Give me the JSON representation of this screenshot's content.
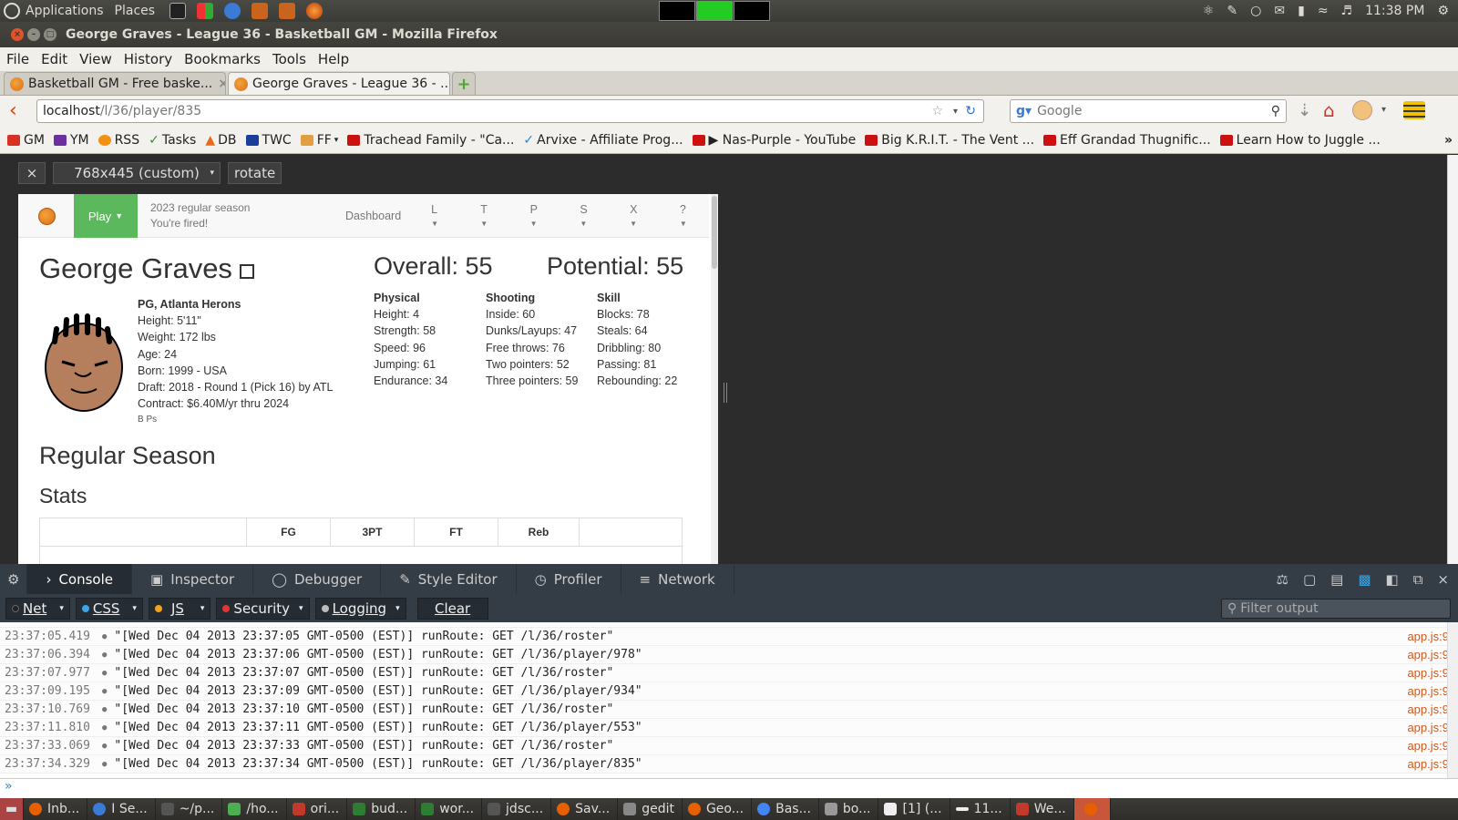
{
  "system": {
    "applications": "Applications",
    "places": "Places",
    "clock": "11:38 PM"
  },
  "window": {
    "title": "George Graves - League 36 - Basketball GM - Mozilla Firefox"
  },
  "menubar": [
    "File",
    "Edit",
    "View",
    "History",
    "Bookmarks",
    "Tools",
    "Help"
  ],
  "tabs": [
    {
      "label": "Basketball GM - Free baske..."
    },
    {
      "label": "George Graves - League 36 - ..."
    }
  ],
  "navbar": {
    "url_host": "localhost",
    "url_path": "/l/36/player/835",
    "search_placeholder": "Google"
  },
  "bookmarks": [
    {
      "label": "GM",
      "color": "#d93025"
    },
    {
      "label": "YM",
      "color": "#6b2fa0"
    },
    {
      "label": "RSS",
      "color": "#f29111"
    },
    {
      "label": "Tasks",
      "color": "#3a8a3a"
    },
    {
      "label": "DB",
      "color": "#e86b1a"
    },
    {
      "label": "TWC",
      "color": "#1a3e9a"
    },
    {
      "label": "FF",
      "color": "#e0a040"
    },
    {
      "label": "Trachead Family - \"Ca...",
      "color": "#cc1111"
    },
    {
      "label": "Arvixe - Affiliate Prog...",
      "color": "#1d8ad6"
    },
    {
      "label": "▶ Nas-Purple - YouTube",
      "color": "#cc1111"
    },
    {
      "label": "Big K.R.I.T. - The Vent ...",
      "color": "#cc1111"
    },
    {
      "label": "Eff Grandad Thugnific...",
      "color": "#cc1111"
    },
    {
      "label": "Learn How to Juggle ...",
      "color": "#cc1111"
    }
  ],
  "rdm": {
    "close": "×",
    "size": "768x445 (custom)",
    "rotate": "rotate"
  },
  "bbgm": {
    "play": "Play",
    "season": "2023 regular season",
    "status": "You're fired!",
    "nav_links": [
      "Dashboard",
      "L",
      "T",
      "P",
      "S",
      "X",
      "?"
    ],
    "player_name": "George Graves",
    "position_team": "PG, Atlanta Herons",
    "height": "Height: 5'11\"",
    "weight": "Weight: 172 lbs",
    "age": "Age: 24",
    "born": "Born: 1999 - USA",
    "draft": "Draft: 2018 - Round 1 (Pick 16) by ATL",
    "contract": "Contract: $6.40M/yr thru 2024",
    "skills_tags": "B Ps",
    "overall": "Overall: 55",
    "potential": "Potential: 55",
    "ratings": [
      {
        "heading": "Physical",
        "items": [
          "Height: 4",
          "Strength: 58",
          "Speed: 96",
          "Jumping: 61",
          "Endurance: 34"
        ]
      },
      {
        "heading": "Shooting",
        "items": [
          "Inside: 60",
          "Dunks/Layups: 47",
          "Free throws: 76",
          "Two pointers: 52",
          "Three pointers: 59"
        ]
      },
      {
        "heading": "Skill",
        "items": [
          "Blocks: 78",
          "Steals: 64",
          "Dribbling: 80",
          "Passing: 81",
          "Rebounding: 22"
        ]
      }
    ],
    "section_title": "Regular Season",
    "subsection_title": "Stats",
    "stat_groups": [
      "FG",
      "3PT",
      "FT",
      "Reb"
    ]
  },
  "devtools": {
    "tabs": [
      "Console",
      "Inspector",
      "Debugger",
      "Style Editor",
      "Profiler",
      "Network"
    ],
    "filters": [
      {
        "label": "Net",
        "dot": "#222"
      },
      {
        "label": "CSS",
        "dot": "#3aa6e6"
      },
      {
        "label": "JS",
        "dot": "#f2a51a"
      },
      {
        "label": "Security",
        "dot": "#e23434"
      },
      {
        "label": "Logging",
        "dot": "#bbbbbb"
      }
    ],
    "clear": "Clear",
    "filter_placeholder": "Filter output",
    "logs": [
      {
        "ts": "23:37:05.419",
        "msg": "\"[Wed Dec 04 2013 23:37:05 GMT-0500 (EST)] runRoute: GET /l/36/roster\"",
        "src": "app.js:9"
      },
      {
        "ts": "23:37:06.394",
        "msg": "\"[Wed Dec 04 2013 23:37:06 GMT-0500 (EST)] runRoute: GET /l/36/player/978\"",
        "src": "app.js:9"
      },
      {
        "ts": "23:37:07.977",
        "msg": "\"[Wed Dec 04 2013 23:37:07 GMT-0500 (EST)] runRoute: GET /l/36/roster\"",
        "src": "app.js:9"
      },
      {
        "ts": "23:37:09.195",
        "msg": "\"[Wed Dec 04 2013 23:37:09 GMT-0500 (EST)] runRoute: GET /l/36/player/934\"",
        "src": "app.js:9"
      },
      {
        "ts": "23:37:10.769",
        "msg": "\"[Wed Dec 04 2013 23:37:10 GMT-0500 (EST)] runRoute: GET /l/36/roster\"",
        "src": "app.js:9"
      },
      {
        "ts": "23:37:11.810",
        "msg": "\"[Wed Dec 04 2013 23:37:11 GMT-0500 (EST)] runRoute: GET /l/36/player/553\"",
        "src": "app.js:9"
      },
      {
        "ts": "23:37:33.069",
        "msg": "\"[Wed Dec 04 2013 23:37:33 GMT-0500 (EST)] runRoute: GET /l/36/roster\"",
        "src": "app.js:9"
      },
      {
        "ts": "23:37:34.329",
        "msg": "\"[Wed Dec 04 2013 23:37:34 GMT-0500 (EST)] runRoute: GET /l/36/player/835\"",
        "src": "app.js:9"
      }
    ],
    "prompt": "»"
  },
  "taskbar": [
    {
      "label": "Inb...",
      "color": "#e66000"
    },
    {
      "label": "I Se...",
      "color": "#3a7bd5"
    },
    {
      "label": "~/p...",
      "color": "#555"
    },
    {
      "label": "/ho...",
      "color": "#4caf50"
    },
    {
      "label": "ori...",
      "color": "#c0392b"
    },
    {
      "label": "bud...",
      "color": "#2e7d32"
    },
    {
      "label": "wor...",
      "color": "#2e7d32"
    },
    {
      "label": "jdsc...",
      "color": "#555"
    },
    {
      "label": "Sav...",
      "color": "#e66000"
    },
    {
      "label": "gedit",
      "color": "#888"
    },
    {
      "label": "Geo...",
      "color": "#e66000"
    },
    {
      "label": "Bas...",
      "color": "#4285f4"
    },
    {
      "label": "bo...",
      "color": "#999"
    },
    {
      "label": "[1] (...",
      "color": "#eee"
    },
    {
      "label": "11...",
      "color": "#eee"
    },
    {
      "label": "We...",
      "color": "#c0392b"
    }
  ]
}
